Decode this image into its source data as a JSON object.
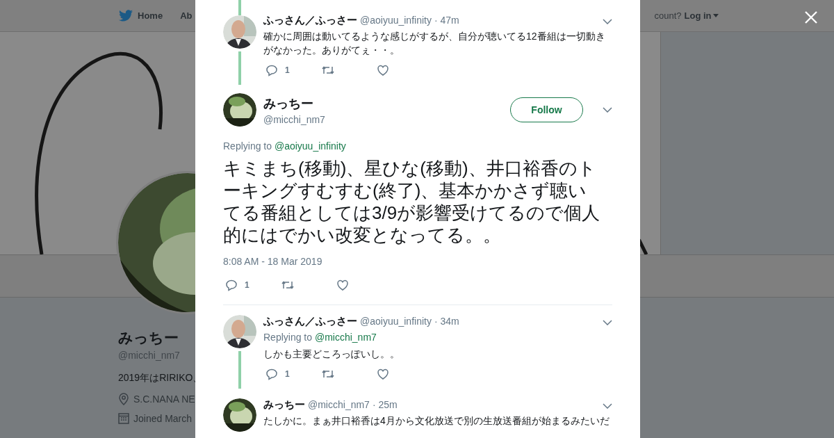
{
  "header": {
    "nav": [
      {
        "label": "Home",
        "kind": "logo"
      },
      {
        "label": "Ab",
        "kind": "text"
      }
    ],
    "account_prompt": "count?",
    "login": "Log in"
  },
  "profile": {
    "name": "みっちー",
    "handle": "@micchi_nm7",
    "bio": "2019年はRIRIKO、",
    "location": "S.C.NANA NE",
    "joined": "Joined March"
  },
  "tweets": [
    {
      "kind": "reply",
      "thread_above": true,
      "thread_below": true,
      "name": "ふっさん／ふっさー",
      "handle": "@aoiyuu_infinity",
      "time": "· 47m",
      "text": "確かに周囲は動いてるような感じがするが、自分が聴いてる12番組は一切動きがなかった。ありがてぇ・・。",
      "replies": "1"
    },
    {
      "kind": "main",
      "name": "みっちー",
      "handle": "@micchi_nm7",
      "follow": "Follow",
      "replying_label": "Replying to",
      "mention": "@aoiyuu_infinity",
      "text": "キミまち(移動)、星ひな(移動)、井口裕香のトーキングすむすむ(終了)、基本かかさず聴いてる番組としては3/9が影響受けてるので個人的にはでかい改変となってる。。",
      "timestamp": "8:08 AM - 18 Mar 2019",
      "replies": "1"
    },
    {
      "kind": "reply",
      "thread_above": false,
      "thread_below": true,
      "name": "ふっさん／ふっさー",
      "handle": "@aoiyuu_infinity",
      "time": "· 34m",
      "replying_label": "Replying to",
      "mention": "@micchi_nm7",
      "text": "しかも主要どころっぽいし。。",
      "replies": "1"
    },
    {
      "kind": "reply",
      "thread_above": false,
      "thread_below": false,
      "name": "みっちー",
      "handle": "@micchi_nm7",
      "time": "· 25m",
      "text": "たしかに。まぁ井口裕香は4月から文化放送で別の生放送番組が始まるみたいだ"
    }
  ]
}
